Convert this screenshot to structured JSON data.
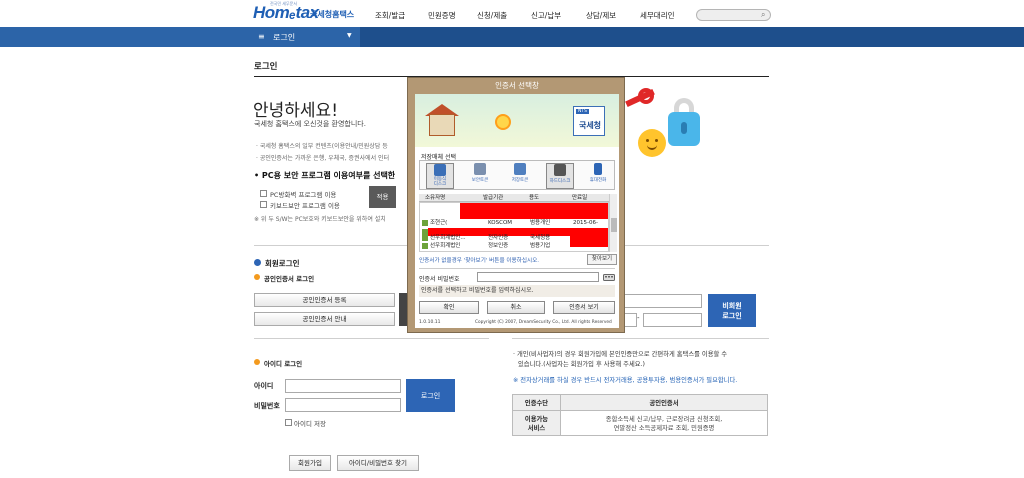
{
  "header": {
    "logo_text": "Homₑtax",
    "logo_tagline": "전국민 세무문서",
    "org_name": "국세청홈택스",
    "nav": [
      "조회/발급",
      "민원증명",
      "신청/제출",
      "신고/납부",
      "상담/제보",
      "세무대리인"
    ],
    "menu_label": "로그인"
  },
  "page": {
    "title": "로그인",
    "hello": "안녕하세요!",
    "welcome": "국세청 홈택스에 오신것을 환영합니다.",
    "bullets": [
      "· 국세청 홈택스의 일부 컨텐츠(이용안내/민원상담 등",
      "· 공인인증서는 가까운 은행, 우체국, 증권사에서 인터"
    ],
    "pc_title": "• PC용 보안 프로그램 이용여부를 선택한",
    "checkboxes": [
      "PC방화벽 프로그램 이용",
      "키보드보안 프로그램 이용"
    ],
    "apply": "적용",
    "note": "※ 위 두 S/W는 PC보호와 키보드보안을 위하여 설치"
  },
  "member": {
    "head": "회원로그인",
    "cert_head": "공인인증서 로그인",
    "cert_register": "공인인증서 등록",
    "cert_guide": "공인인증서 안내",
    "id_head": "아이디 로그인",
    "id_label": "아이디",
    "pw_label": "비밀번호",
    "login": "로그인",
    "save_id": "아이디 저장",
    "join": "회원가입",
    "find": "아이디/비밀번호 찾기"
  },
  "nonmember": {
    "login": "비회원\n로그인",
    "dash": "-",
    "desc1": "· 개인(비사업자)의 경우 회원가입에 본인인증만으로 간편하게 홈택스를 이용할 수",
    "desc2": "있습니다.(사업자는 회원가입 후 사용해 주세요.)",
    "notice": "※ 전자상거래를 하실 경우 반드시 전자거래용, 공용투자용, 범용인증서가 필요합니다.",
    "table": {
      "headers": [
        "인증수단",
        "공인인증서"
      ],
      "row_head": "이용가능\n서비스",
      "row_value": "종합소득세 신고/납부, 근로장려금 신청조회,\n연말정산 소득공제자료 조회, 민원증명"
    }
  },
  "dialog": {
    "title": "인증서 선택창",
    "logo": "국세청",
    "logo_badge": "NTS",
    "media_label": "저장매체 선택",
    "media": [
      {
        "label": "이동식\n디스크",
        "icon": "usb-disk-icon",
        "color": "#3b6fb7"
      },
      {
        "label": "보안토큰",
        "icon": "security-token-icon",
        "color": "#7a8fae"
      },
      {
        "label": "저장토큰",
        "icon": "storage-token-icon",
        "color": "#4f7fbf"
      },
      {
        "label": "하드디스크",
        "icon": "hard-disk-icon",
        "color": "#555"
      },
      {
        "label": "휴대전화",
        "icon": "mobile-phone-icon",
        "color": "#2d65b5"
      }
    ],
    "columns": [
      "소유자명",
      "발급기관",
      "용도",
      "만료일"
    ],
    "rows": [
      {
        "owner": "조현근(",
        "issuer": "KOSCOM",
        "usage": "범용개인",
        "expiry": "2015-06-"
      },
      {
        "owner": "선우회계법인...",
        "issuer": "전자인증",
        "usage": "국세청용",
        "expiry": ""
      },
      {
        "owner": "선우회계법인",
        "issuer": "정보인증",
        "usage": "범용기업",
        "expiry": ""
      }
    ],
    "hint": "인증서가 없을경우 '찾아보기' 버튼을 이용하십시오.",
    "find": "찾아보기",
    "pw_label": "인증서 비밀번호",
    "message": "인증서를 선택하고 비밀번호를 입력하십시오.",
    "ok": "확인",
    "cancel": "취소",
    "view": "인증서 보기",
    "version": "1.0.10.11",
    "copyright": "Copyright (C) 2007, DreamSecurity Co., Ltd. All rights Reserved"
  },
  "colors": {
    "header_blue": "#1e4f8c",
    "button_blue": "#2d65b5",
    "redaction": "#ff0000",
    "dialog_frame": "#b39874"
  }
}
